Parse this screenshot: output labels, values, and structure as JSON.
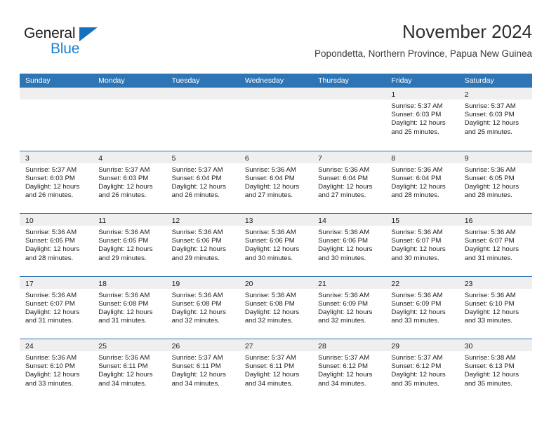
{
  "brand": {
    "name_part1": "General",
    "name_part2": "Blue",
    "triangle_color": "#1571bb",
    "blue_color": "#1b81d0"
  },
  "header": {
    "title": "November 2024",
    "subtitle": "Popondetta, Northern Province, Papua New Guinea"
  },
  "colors": {
    "header_blue": "#2e75b6",
    "daynum_band": "#efefef",
    "text": "#1d1d1d"
  },
  "calendar": {
    "weekday_headers": [
      "Sunday",
      "Monday",
      "Tuesday",
      "Wednesday",
      "Thursday",
      "Friday",
      "Saturday"
    ],
    "weeks": [
      [
        {
          "day": "",
          "empty": true
        },
        {
          "day": "",
          "empty": true
        },
        {
          "day": "",
          "empty": true
        },
        {
          "day": "",
          "empty": true
        },
        {
          "day": "",
          "empty": true
        },
        {
          "day": "1",
          "sunrise": "Sunrise: 5:37 AM",
          "sunset": "Sunset: 6:03 PM",
          "daylight1": "Daylight: 12 hours",
          "daylight2": "and 25 minutes."
        },
        {
          "day": "2",
          "sunrise": "Sunrise: 5:37 AM",
          "sunset": "Sunset: 6:03 PM",
          "daylight1": "Daylight: 12 hours",
          "daylight2": "and 25 minutes."
        }
      ],
      [
        {
          "day": "3",
          "sunrise": "Sunrise: 5:37 AM",
          "sunset": "Sunset: 6:03 PM",
          "daylight1": "Daylight: 12 hours",
          "daylight2": "and 26 minutes."
        },
        {
          "day": "4",
          "sunrise": "Sunrise: 5:37 AM",
          "sunset": "Sunset: 6:03 PM",
          "daylight1": "Daylight: 12 hours",
          "daylight2": "and 26 minutes."
        },
        {
          "day": "5",
          "sunrise": "Sunrise: 5:37 AM",
          "sunset": "Sunset: 6:04 PM",
          "daylight1": "Daylight: 12 hours",
          "daylight2": "and 26 minutes."
        },
        {
          "day": "6",
          "sunrise": "Sunrise: 5:36 AM",
          "sunset": "Sunset: 6:04 PM",
          "daylight1": "Daylight: 12 hours",
          "daylight2": "and 27 minutes."
        },
        {
          "day": "7",
          "sunrise": "Sunrise: 5:36 AM",
          "sunset": "Sunset: 6:04 PM",
          "daylight1": "Daylight: 12 hours",
          "daylight2": "and 27 minutes."
        },
        {
          "day": "8",
          "sunrise": "Sunrise: 5:36 AM",
          "sunset": "Sunset: 6:04 PM",
          "daylight1": "Daylight: 12 hours",
          "daylight2": "and 28 minutes."
        },
        {
          "day": "9",
          "sunrise": "Sunrise: 5:36 AM",
          "sunset": "Sunset: 6:05 PM",
          "daylight1": "Daylight: 12 hours",
          "daylight2": "and 28 minutes."
        }
      ],
      [
        {
          "day": "10",
          "sunrise": "Sunrise: 5:36 AM",
          "sunset": "Sunset: 6:05 PM",
          "daylight1": "Daylight: 12 hours",
          "daylight2": "and 28 minutes."
        },
        {
          "day": "11",
          "sunrise": "Sunrise: 5:36 AM",
          "sunset": "Sunset: 6:05 PM",
          "daylight1": "Daylight: 12 hours",
          "daylight2": "and 29 minutes."
        },
        {
          "day": "12",
          "sunrise": "Sunrise: 5:36 AM",
          "sunset": "Sunset: 6:06 PM",
          "daylight1": "Daylight: 12 hours",
          "daylight2": "and 29 minutes."
        },
        {
          "day": "13",
          "sunrise": "Sunrise: 5:36 AM",
          "sunset": "Sunset: 6:06 PM",
          "daylight1": "Daylight: 12 hours",
          "daylight2": "and 30 minutes."
        },
        {
          "day": "14",
          "sunrise": "Sunrise: 5:36 AM",
          "sunset": "Sunset: 6:06 PM",
          "daylight1": "Daylight: 12 hours",
          "daylight2": "and 30 minutes."
        },
        {
          "day": "15",
          "sunrise": "Sunrise: 5:36 AM",
          "sunset": "Sunset: 6:07 PM",
          "daylight1": "Daylight: 12 hours",
          "daylight2": "and 30 minutes."
        },
        {
          "day": "16",
          "sunrise": "Sunrise: 5:36 AM",
          "sunset": "Sunset: 6:07 PM",
          "daylight1": "Daylight: 12 hours",
          "daylight2": "and 31 minutes."
        }
      ],
      [
        {
          "day": "17",
          "sunrise": "Sunrise: 5:36 AM",
          "sunset": "Sunset: 6:07 PM",
          "daylight1": "Daylight: 12 hours",
          "daylight2": "and 31 minutes."
        },
        {
          "day": "18",
          "sunrise": "Sunrise: 5:36 AM",
          "sunset": "Sunset: 6:08 PM",
          "daylight1": "Daylight: 12 hours",
          "daylight2": "and 31 minutes."
        },
        {
          "day": "19",
          "sunrise": "Sunrise: 5:36 AM",
          "sunset": "Sunset: 6:08 PM",
          "daylight1": "Daylight: 12 hours",
          "daylight2": "and 32 minutes."
        },
        {
          "day": "20",
          "sunrise": "Sunrise: 5:36 AM",
          "sunset": "Sunset: 6:08 PM",
          "daylight1": "Daylight: 12 hours",
          "daylight2": "and 32 minutes."
        },
        {
          "day": "21",
          "sunrise": "Sunrise: 5:36 AM",
          "sunset": "Sunset: 6:09 PM",
          "daylight1": "Daylight: 12 hours",
          "daylight2": "and 32 minutes."
        },
        {
          "day": "22",
          "sunrise": "Sunrise: 5:36 AM",
          "sunset": "Sunset: 6:09 PM",
          "daylight1": "Daylight: 12 hours",
          "daylight2": "and 33 minutes."
        },
        {
          "day": "23",
          "sunrise": "Sunrise: 5:36 AM",
          "sunset": "Sunset: 6:10 PM",
          "daylight1": "Daylight: 12 hours",
          "daylight2": "and 33 minutes."
        }
      ],
      [
        {
          "day": "24",
          "sunrise": "Sunrise: 5:36 AM",
          "sunset": "Sunset: 6:10 PM",
          "daylight1": "Daylight: 12 hours",
          "daylight2": "and 33 minutes."
        },
        {
          "day": "25",
          "sunrise": "Sunrise: 5:36 AM",
          "sunset": "Sunset: 6:11 PM",
          "daylight1": "Daylight: 12 hours",
          "daylight2": "and 34 minutes."
        },
        {
          "day": "26",
          "sunrise": "Sunrise: 5:37 AM",
          "sunset": "Sunset: 6:11 PM",
          "daylight1": "Daylight: 12 hours",
          "daylight2": "and 34 minutes."
        },
        {
          "day": "27",
          "sunrise": "Sunrise: 5:37 AM",
          "sunset": "Sunset: 6:11 PM",
          "daylight1": "Daylight: 12 hours",
          "daylight2": "and 34 minutes."
        },
        {
          "day": "28",
          "sunrise": "Sunrise: 5:37 AM",
          "sunset": "Sunset: 6:12 PM",
          "daylight1": "Daylight: 12 hours",
          "daylight2": "and 34 minutes."
        },
        {
          "day": "29",
          "sunrise": "Sunrise: 5:37 AM",
          "sunset": "Sunset: 6:12 PM",
          "daylight1": "Daylight: 12 hours",
          "daylight2": "and 35 minutes."
        },
        {
          "day": "30",
          "sunrise": "Sunrise: 5:38 AM",
          "sunset": "Sunset: 6:13 PM",
          "daylight1": "Daylight: 12 hours",
          "daylight2": "and 35 minutes."
        }
      ]
    ]
  }
}
